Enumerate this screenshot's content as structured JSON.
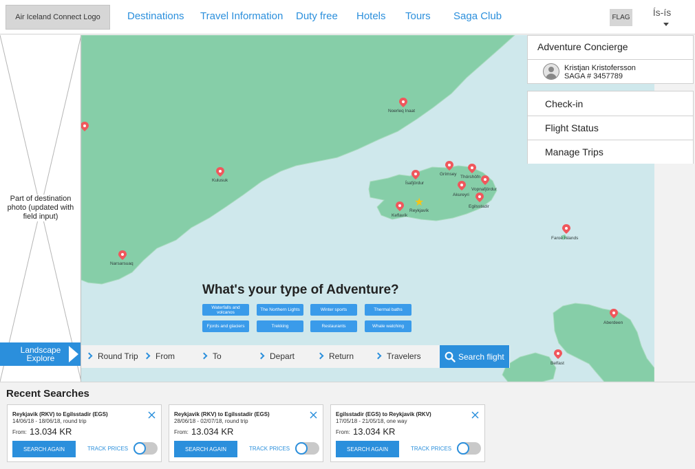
{
  "header": {
    "logo_text": "Air Iceland Connect Logo",
    "nav": [
      "Destinations",
      "Travel Information",
      "Duty free",
      "Hotels",
      "Tours",
      "Saga Club"
    ],
    "flag_text": "FLAG",
    "language": "Ís-ís"
  },
  "left_panel": {
    "placeholder_text": "Part of destination photo (updated with field input)",
    "landscape_button": "Landscape Explore"
  },
  "map": {
    "places": [
      "Noerleq Inaat",
      "Kulusuk",
      "Narsarsuaq",
      "Ísafjördur",
      "Grímsey",
      "Thórshöfn",
      "Akureyri",
      "Vopnafjördur",
      "Egilsstadir",
      "Reykjavík",
      "Keflavík",
      "Faroe Islands",
      "Aberdeen",
      "Belfast"
    ],
    "colors": {
      "water": "#cfe8ec",
      "land": "#86cea8",
      "pin": "#f0575c",
      "accent": "#2b8fdc"
    }
  },
  "adventure": {
    "title": "What's your type of Adventure?",
    "tags": [
      "Waterfalls and volcanos",
      "The Northern Lights",
      "Winter sports",
      "Thermal baths",
      "Fjords and glaciers",
      "Trekking",
      "Restaurants",
      "Whale watching"
    ]
  },
  "search": {
    "fields": [
      "Round Trip",
      "From",
      "To",
      "Depart",
      "Return",
      "Travelers"
    ],
    "button": "Search flight"
  },
  "concierge": {
    "title": "Adventure Concierge",
    "user_name": "Kristjan Kristofersson",
    "saga_number": "SAGA # 3457789",
    "menu": [
      "Check-in",
      "Flight Status",
      "Manage Trips"
    ]
  },
  "recent": {
    "title": "Recent Searches",
    "from_label": "From:",
    "search_again": "SEARCH AGAIN",
    "track_prices": "TRACK PRICES",
    "cards": [
      {
        "route": "Reykjavik (RKV) to Egilsstadir (EGS)",
        "dates": "14/06/18 - 18/06/18, round trip",
        "price": "13.034 KR"
      },
      {
        "route": "Reykjavik (RKV) to Egilsstadir (EGS)",
        "dates": "28/06/18 - 02/07/18, round trip",
        "price": "13.034 KR"
      },
      {
        "route": "Egilsstadir (EGS) to Reykjavik (RKV)",
        "dates": "17/05/18 - 21/05/18, one way",
        "price": "13.034 KR"
      }
    ]
  }
}
